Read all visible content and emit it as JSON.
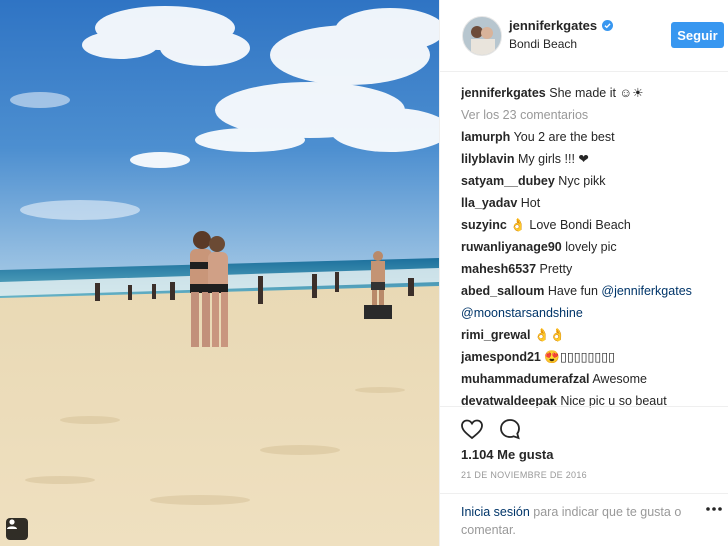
{
  "header": {
    "username": "jenniferkgates",
    "location": "Bondi Beach",
    "follow_label": "Seguir"
  },
  "caption": {
    "user": "jenniferkgates",
    "text": "She made it ☺☀"
  },
  "view_all_comments": "Ver los 23 comentarios",
  "comments": [
    {
      "user": "lamurph",
      "text": "You 2 are the best"
    },
    {
      "user": "lilyblavin",
      "text": "My girls !!! ❤"
    },
    {
      "user": "satyam__dubey",
      "text": "Nyc pikk"
    },
    {
      "user": "lla_yadav",
      "text": "Hot"
    },
    {
      "user": "suzyinc",
      "text": "👌 Love Bondi Beach"
    },
    {
      "user": "ruwanliyanage90",
      "text": "lovely pic"
    },
    {
      "user": "mahesh6537",
      "text": "Pretty"
    },
    {
      "user": "abed_salloum",
      "text": "Have fun",
      "mention1": "@jenniferkgates",
      "mention2": "@moonstarsandshine"
    },
    {
      "user": "rimi_grewal",
      "text": "👌👌"
    },
    {
      "user": "jamespond21",
      "text": "😍▯▯▯▯▯▯▯▯"
    },
    {
      "user": "muhammadumerafzal",
      "text": "Awesome"
    },
    {
      "user": "devatwaldeepak",
      "text": "Nice pic u so beaut"
    }
  ],
  "likes": "1.104 Me gusta",
  "date": "21 DE NOVIEMBRE DE 2016",
  "footer": {
    "login": "Inicia sesión",
    "rest": " para indicar que te gusta o comentar."
  },
  "icons": {
    "like": "heart-icon",
    "comment": "comment-icon",
    "verified": "verified-badge-icon",
    "tag": "user-tag-icon",
    "more": "more-options-icon"
  },
  "colors": {
    "follow_button": "#3897f0",
    "mention": "#003569",
    "muted": "#999999"
  }
}
